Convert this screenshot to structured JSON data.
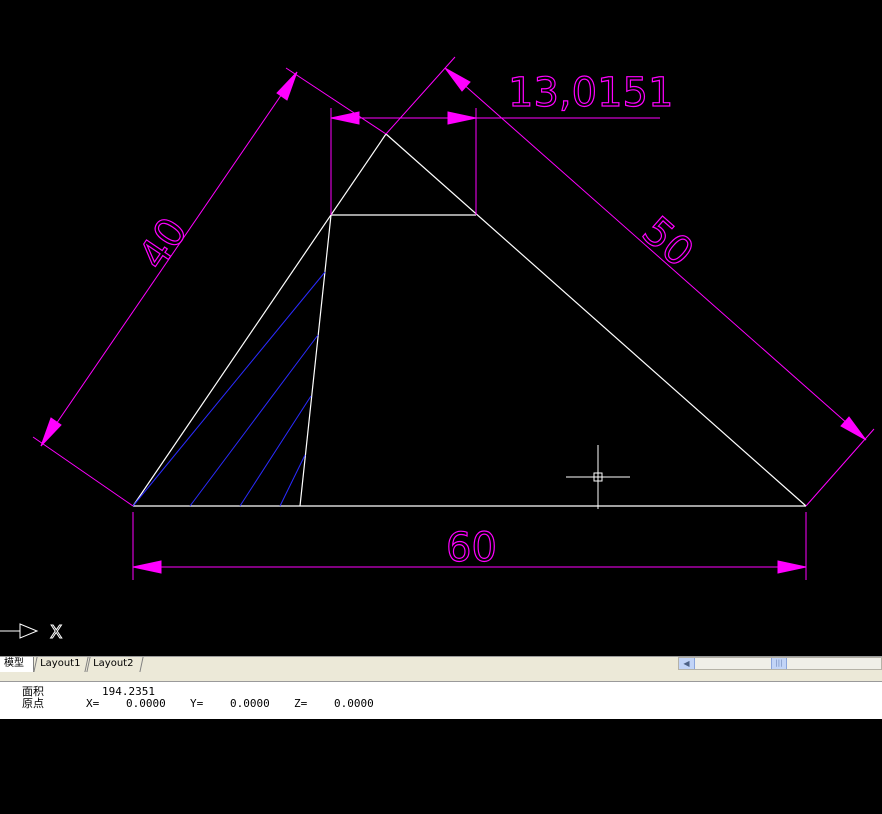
{
  "drawing": {
    "background_color": "#000000",
    "geometry_color": "#ffffff",
    "dimension_color": "#ff00ff",
    "hatch_color": "#2b2bff",
    "dimensions": {
      "dim_top": "13,0151",
      "dim_left": "40",
      "dim_right": "50",
      "dim_bottom": "60"
    },
    "ucs_icon_axis": "X"
  },
  "tabs": {
    "model": "模型",
    "layout1": "Layout1",
    "layout2": "Layout2"
  },
  "command": {
    "area_label": "面积",
    "area_value": "194.2351",
    "origin_label": "原点",
    "x_label": "X=",
    "x_value": "0.0000",
    "y_label": "Y=",
    "y_value": "0.0000",
    "z_label": "Z=",
    "z_value": "0.0000"
  }
}
